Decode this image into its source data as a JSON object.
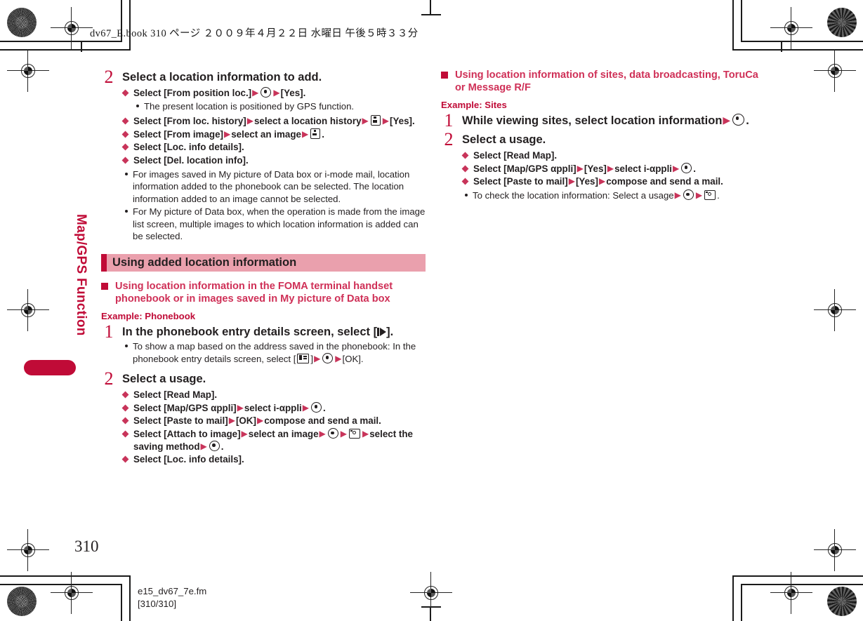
{
  "header": {
    "line": "dv67_E.book   310 ページ   ２００９年４月２２日   水曜日   午後５時３３分"
  },
  "side_tab": {
    "label": "Map/GPS Function",
    "color": "#c00b37"
  },
  "footer": {
    "page_number": "310",
    "file_name": "e15_dv67_7e.fm",
    "page_range": "[310/310]"
  },
  "colors": {
    "accent_red": "#c00b37",
    "section_bar_bg": "#eaa0ad",
    "heading_red": "#cf3057",
    "diamond": "#c8345a",
    "body": "#231f20"
  },
  "left_column": {
    "step2": {
      "number": "2",
      "title": "Select a location information to add.",
      "items": [
        {
          "segments": [
            {
              "t": "text",
              "v": "Select [From position loc.]"
            },
            {
              "t": "arrow"
            },
            {
              "t": "icon",
              "v": "center-key-icon"
            },
            {
              "t": "arrow"
            },
            {
              "t": "text",
              "v": "[Yes]."
            }
          ]
        },
        {
          "sub_note": "The present location is positioned by GPS function."
        },
        {
          "segments": [
            {
              "t": "text",
              "v": "Select [From loc. history]"
            },
            {
              "t": "arrow"
            },
            {
              "t": "text",
              "v": "select a location history"
            },
            {
              "t": "arrow"
            },
            {
              "t": "icon",
              "v": "function-key-icon"
            },
            {
              "t": "arrow"
            },
            {
              "t": "text",
              "v": "[Yes]."
            }
          ]
        },
        {
          "segments": [
            {
              "t": "text",
              "v": "Select [From image]"
            },
            {
              "t": "arrow"
            },
            {
              "t": "text",
              "v": "select an image"
            },
            {
              "t": "arrow"
            },
            {
              "t": "icon",
              "v": "function-key-icon"
            },
            {
              "t": "text",
              "v": "."
            }
          ]
        },
        {
          "segments": [
            {
              "t": "text",
              "v": "Select [Loc. info details]."
            }
          ]
        },
        {
          "segments": [
            {
              "t": "text",
              "v": "Select [Del. location info]."
            }
          ]
        }
      ],
      "notes": [
        "For images saved in My picture of Data box or i-mode mail, location information added to the phonebook can be selected. The location information added to an image cannot be selected.",
        "For My picture of Data box, when the operation is made from the image list screen, multiple images to which location information is added can be selected."
      ]
    },
    "section": {
      "title": "Using added location information"
    },
    "sub_heading": "Using location information in the FOMA terminal handset phonebook or in images saved in My picture of Data box",
    "example_label": "Example: Phonebook",
    "step1": {
      "number": "1",
      "title_before": "In the phonebook entry details screen, select [",
      "title_icon": "play-key-icon",
      "title_after": "].",
      "note_before": "To show a map based on the address saved in the phonebook: In the phonebook entry details screen, select [",
      "note_icon": "mail-key-icon",
      "note_after": "]",
      "note_end": "[OK]."
    },
    "step2b": {
      "number": "2",
      "title": "Select a usage.",
      "items": [
        {
          "segments": [
            {
              "t": "text",
              "v": "Select [Read Map]."
            }
          ]
        },
        {
          "segments": [
            {
              "t": "text",
              "v": "Select [Map/GPS αppli]"
            },
            {
              "t": "arrow"
            },
            {
              "t": "text",
              "v": "select i-αppli"
            },
            {
              "t": "arrow"
            },
            {
              "t": "icon",
              "v": "center-key-icon"
            },
            {
              "t": "text",
              "v": "."
            }
          ]
        },
        {
          "segments": [
            {
              "t": "text",
              "v": "Select [Paste to mail]"
            },
            {
              "t": "arrow"
            },
            {
              "t": "text",
              "v": "[OK]"
            },
            {
              "t": "arrow"
            },
            {
              "t": "text",
              "v": "compose and send a mail."
            }
          ]
        },
        {
          "segments": [
            {
              "t": "text",
              "v": "Select [Attach to image]"
            },
            {
              "t": "arrow"
            },
            {
              "t": "text",
              "v": "select an image"
            },
            {
              "t": "arrow"
            },
            {
              "t": "icon",
              "v": "center-key-icon"
            },
            {
              "t": "arrow"
            },
            {
              "t": "icon",
              "v": "camera-key-icon"
            },
            {
              "t": "arrow"
            },
            {
              "t": "text",
              "v": "select the saving method"
            },
            {
              "t": "arrow"
            },
            {
              "t": "icon",
              "v": "center-key-icon"
            },
            {
              "t": "text",
              "v": "."
            }
          ]
        },
        {
          "segments": [
            {
              "t": "text",
              "v": "Select [Loc. info details]."
            }
          ]
        }
      ]
    }
  },
  "right_column": {
    "sub_heading": "Using location information of sites, data broadcasting, ToruCa or Message R/F",
    "example_label": "Example: Sites",
    "step1": {
      "number": "1",
      "title_before": "While viewing sites, select location information",
      "title_icon": "center-key-icon",
      "title_after": "."
    },
    "step2": {
      "number": "2",
      "title": "Select a usage.",
      "items": [
        {
          "segments": [
            {
              "t": "text",
              "v": "Select [Read Map]."
            }
          ]
        },
        {
          "segments": [
            {
              "t": "text",
              "v": "Select [Map/GPS αppli]"
            },
            {
              "t": "arrow"
            },
            {
              "t": "text",
              "v": "[Yes]"
            },
            {
              "t": "arrow"
            },
            {
              "t": "text",
              "v": "select i-αppli"
            },
            {
              "t": "arrow"
            },
            {
              "t": "icon",
              "v": "center-key-icon"
            },
            {
              "t": "text",
              "v": "."
            }
          ]
        },
        {
          "segments": [
            {
              "t": "text",
              "v": "Select [Paste to mail]"
            },
            {
              "t": "arrow"
            },
            {
              "t": "text",
              "v": "[Yes]"
            },
            {
              "t": "arrow"
            },
            {
              "t": "text",
              "v": "compose and send a mail."
            }
          ]
        }
      ],
      "note": {
        "before": "To check the location information: Select a usage",
        "icon1": "center-key-icon",
        "icon2": "camera-key-icon",
        "after": "."
      }
    }
  }
}
